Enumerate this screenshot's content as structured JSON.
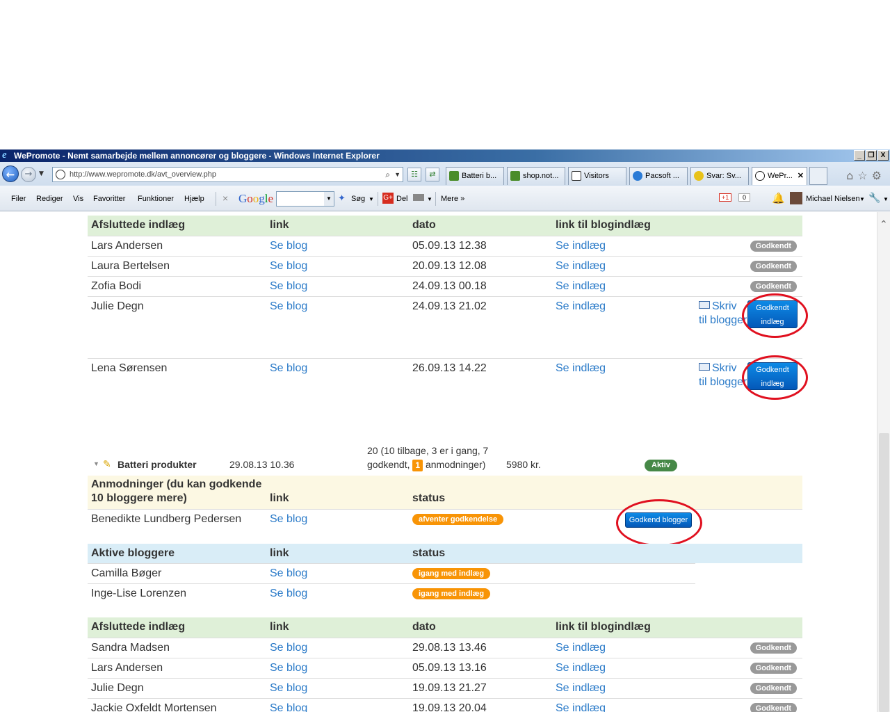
{
  "window": {
    "title": "WePromote - Nemt samarbejde mellem annoncører og bloggere - Windows Internet Explorer",
    "controls": [
      "_",
      "❐",
      "X"
    ]
  },
  "nav": {
    "address": "http://www.wepromote.dk/avt_overview.php",
    "tabs": [
      {
        "label": "Batteri b...",
        "color": "#4a8c2a"
      },
      {
        "label": "shop.not...",
        "color": "#4a8c2a"
      },
      {
        "label": "Visitors",
        "color": "#333333"
      },
      {
        "label": "Pacsoft ...",
        "color": "#2b7bd6"
      },
      {
        "label": "Svar: Sv...",
        "color": "#e8c21a"
      },
      {
        "label": "WePr...",
        "color": "#222222"
      }
    ],
    "right_icons": "⌂☆⚙"
  },
  "menu": {
    "items": [
      "Filer",
      "Rediger",
      "Vis",
      "Favoritter",
      "Funktioner",
      "Hjælp"
    ],
    "close_x": "×",
    "google_b1": "G",
    "google_r1": "o",
    "google_y": "o",
    "google_b2": "g",
    "google_g": "l",
    "google_r2": "e",
    "search_label": "Søg",
    "share_label": "Del",
    "more_label": "Mere »",
    "gplus_label": "+1",
    "gplus_count": "0",
    "user_name": "Michael Nielsen"
  },
  "section1": {
    "header": {
      "name": "Afsluttede indlæg",
      "link": "link",
      "date": "dato",
      "post": "link til blogindlæg"
    },
    "rows": [
      {
        "name": "Lars Andersen",
        "link": "Se blog",
        "date": "05.09.13 12.38",
        "post": "Se indlæg",
        "status": "Godkendt"
      },
      {
        "name": "Laura Bertelsen",
        "link": "Se blog",
        "date": "20.09.13 12.08",
        "post": "Se indlæg",
        "status": "Godkendt"
      },
      {
        "name": "Zofia Bodi",
        "link": "Se blog",
        "date": "24.09.13 00.18",
        "post": "Se indlæg",
        "status": "Godkendt"
      },
      {
        "name": "Julie Degn",
        "link": "Se blog",
        "date": "24.09.13 21.02",
        "post": "Se indlæg",
        "write": "Skriv til blogger",
        "approve1": "Godkendt",
        "approve2": "indlæg"
      },
      {
        "name": "Lena Sørensen",
        "link": "Se blog",
        "date": "26.09.13 14.22",
        "post": "Se indlæg",
        "write": "Skriv til blogger",
        "approve1": "Godkendt",
        "approve2": "indlæg"
      }
    ]
  },
  "campaign": {
    "name": "Batteri produkter",
    "date": "29.08.13 10.36",
    "stats_line1": "20 (10 tilbage, 3 er i gang, 7",
    "stats_line2a": "godkendt,",
    "stats_num": "1",
    "stats_line2b": "anmodninger)",
    "price": "5980 kr.",
    "status": "Aktiv"
  },
  "requests": {
    "header": {
      "name_line1": "Anmodninger (du kan godkende",
      "name_line2": "10 bloggere mere)",
      "link": "link",
      "status": "status"
    },
    "rows": [
      {
        "name": "Benedikte Lundberg Pedersen",
        "link": "Se blog",
        "status": "afventer godkendelse",
        "action": "Godkend blogger"
      }
    ]
  },
  "active": {
    "header": {
      "name": "Aktive bloggere",
      "link": "link",
      "status": "status"
    },
    "rows": [
      {
        "name": "Camilla Bøger",
        "link": "Se blog",
        "status": "igang med indlæg"
      },
      {
        "name": "Inge-Lise Lorenzen",
        "link": "Se blog",
        "status": "igang med indlæg"
      }
    ]
  },
  "section2": {
    "header": {
      "name": "Afsluttede indlæg",
      "link": "link",
      "date": "dato",
      "post": "link til blogindlæg"
    },
    "rows": [
      {
        "name": "Sandra Madsen",
        "link": "Se blog",
        "date": "29.08.13 13.46",
        "post": "Se indlæg",
        "status": "Godkendt"
      },
      {
        "name": "Lars Andersen",
        "link": "Se blog",
        "date": "05.09.13 13.16",
        "post": "Se indlæg",
        "status": "Godkendt"
      },
      {
        "name": "Julie Degn",
        "link": "Se blog",
        "date": "19.09.13 21.27",
        "post": "Se indlæg",
        "status": "Godkendt"
      },
      {
        "name": "Jackie Oxfeldt Mortensen",
        "link": "Se blog",
        "date": "19.09.13 20.04",
        "post": "Se indlæg",
        "status": "Godkendt"
      }
    ]
  }
}
